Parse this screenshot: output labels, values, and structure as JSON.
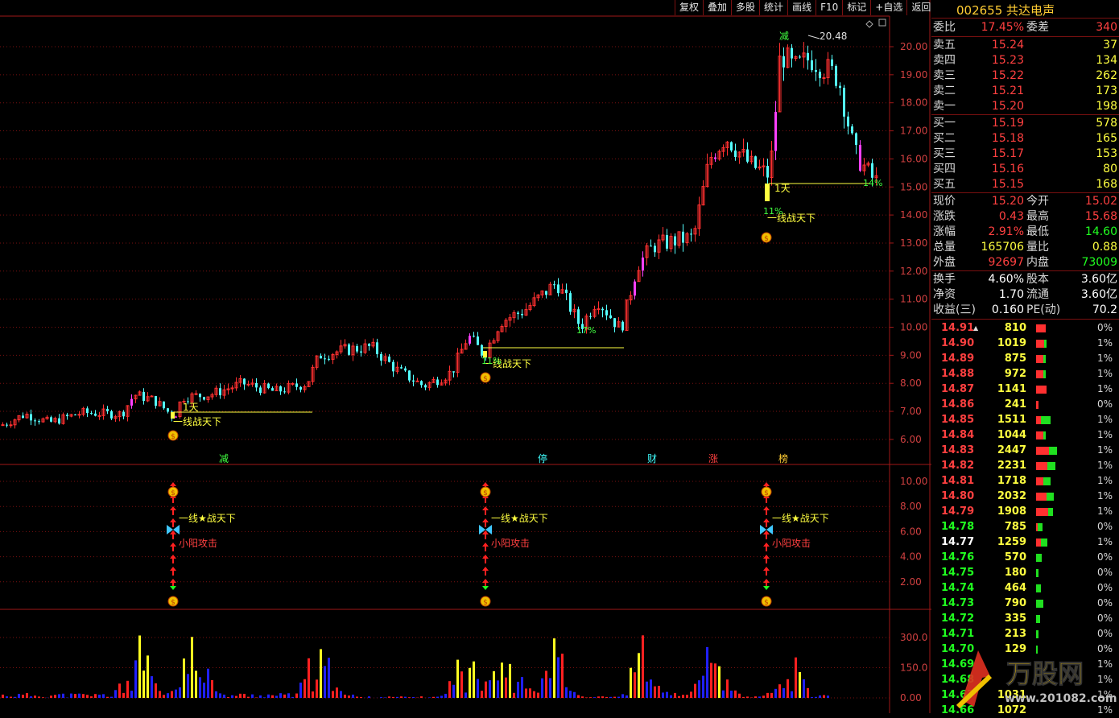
{
  "toolbar": [
    "复权",
    "叠加",
    "多股",
    "统计",
    "画线",
    "F10",
    "标记",
    "+自选",
    "返回"
  ],
  "stock": {
    "code": "002655",
    "name": "共达电声"
  },
  "summary": {
    "weibi_label": "委比",
    "weibi": "17.45%",
    "weicha_label": "委差",
    "weicha": "340"
  },
  "asks": [
    {
      "label": "卖五",
      "price": "15.24",
      "vol": "37"
    },
    {
      "label": "卖四",
      "price": "15.23",
      "vol": "134"
    },
    {
      "label": "卖三",
      "price": "15.22",
      "vol": "262"
    },
    {
      "label": "卖二",
      "price": "15.21",
      "vol": "173"
    },
    {
      "label": "卖一",
      "price": "15.20",
      "vol": "198"
    }
  ],
  "bids": [
    {
      "label": "买一",
      "price": "15.19",
      "vol": "578"
    },
    {
      "label": "买二",
      "price": "15.18",
      "vol": "165"
    },
    {
      "label": "买三",
      "price": "15.17",
      "vol": "153"
    },
    {
      "label": "买四",
      "price": "15.16",
      "vol": "80"
    },
    {
      "label": "买五",
      "price": "15.15",
      "vol": "168"
    }
  ],
  "quote": [
    {
      "l1": "现价",
      "v1": "15.20",
      "c1": "red",
      "l2": "今开",
      "v2": "15.02",
      "c2": "red"
    },
    {
      "l1": "涨跌",
      "v1": "0.43",
      "c1": "red",
      "l2": "最高",
      "v2": "15.68",
      "c2": "red"
    },
    {
      "l1": "涨幅",
      "v1": "2.91%",
      "c1": "red",
      "l2": "最低",
      "v2": "14.60",
      "c2": "green"
    },
    {
      "l1": "总量",
      "v1": "165706",
      "c1": "yel",
      "l2": "量比",
      "v2": "0.88",
      "c2": "yel"
    },
    {
      "l1": "外盘",
      "v1": "92697",
      "c1": "red",
      "l2": "内盘",
      "v2": "73009",
      "c2": "green"
    }
  ],
  "finance": [
    {
      "l1": "换手",
      "v1": "4.60%",
      "l2": "股本",
      "v2": "3.60亿"
    },
    {
      "l1": "净资",
      "v1": "1.70",
      "l2": "流通",
      "v2": "3.60亿"
    },
    {
      "l1": "收益(三)",
      "v1": "0.160",
      "l2": "PE(动)",
      "v2": "70.2"
    }
  ],
  "levels": [
    {
      "p": "14.91",
      "q": "810",
      "pc": "0%",
      "c": "red",
      "r": 12,
      "g": 0
    },
    {
      "p": "14.90",
      "q": "1019",
      "pc": "1%",
      "c": "red",
      "r": 10,
      "g": 3
    },
    {
      "p": "14.89",
      "q": "875",
      "pc": "1%",
      "c": "red",
      "r": 9,
      "g": 3
    },
    {
      "p": "14.88",
      "q": "972",
      "pc": "1%",
      "c": "red",
      "r": 9,
      "g": 3
    },
    {
      "p": "14.87",
      "q": "1141",
      "pc": "1%",
      "c": "red",
      "r": 13,
      "g": 0
    },
    {
      "p": "14.86",
      "q": "241",
      "pc": "0%",
      "c": "red",
      "r": 3,
      "g": 0
    },
    {
      "p": "14.85",
      "q": "1511",
      "pc": "1%",
      "c": "red",
      "r": 6,
      "g": 12
    },
    {
      "p": "14.84",
      "q": "1044",
      "pc": "1%",
      "c": "red",
      "r": 9,
      "g": 3
    },
    {
      "p": "14.83",
      "q": "2447",
      "pc": "1%",
      "c": "red",
      "r": 16,
      "g": 10
    },
    {
      "p": "14.82",
      "q": "2231",
      "pc": "1%",
      "c": "red",
      "r": 14,
      "g": 10
    },
    {
      "p": "14.81",
      "q": "1718",
      "pc": "1%",
      "c": "red",
      "r": 9,
      "g": 9
    },
    {
      "p": "14.80",
      "q": "2032",
      "pc": "1%",
      "c": "red",
      "r": 13,
      "g": 9
    },
    {
      "p": "14.79",
      "q": "1908",
      "pc": "1%",
      "c": "red",
      "r": 15,
      "g": 6
    },
    {
      "p": "14.78",
      "q": "785",
      "pc": "0%",
      "c": "green",
      "r": 2,
      "g": 6
    },
    {
      "p": "14.77",
      "q": "1259",
      "pc": "1%",
      "c": "white",
      "r": 6,
      "g": 8
    },
    {
      "p": "14.76",
      "q": "570",
      "pc": "0%",
      "c": "green",
      "r": 0,
      "g": 7
    },
    {
      "p": "14.75",
      "q": "180",
      "pc": "0%",
      "c": "green",
      "r": 0,
      "g": 3
    },
    {
      "p": "14.74",
      "q": "464",
      "pc": "0%",
      "c": "green",
      "r": 0,
      "g": 6
    },
    {
      "p": "14.73",
      "q": "790",
      "pc": "0%",
      "c": "green",
      "r": 0,
      "g": 9
    },
    {
      "p": "14.72",
      "q": "335",
      "pc": "0%",
      "c": "green",
      "r": 0,
      "g": 5
    },
    {
      "p": "14.71",
      "q": "213",
      "pc": "0%",
      "c": "green",
      "r": 0,
      "g": 3
    },
    {
      "p": "14.70",
      "q": "129",
      "pc": "0%",
      "c": "green",
      "r": 0,
      "g": 2
    },
    {
      "p": "14.69",
      "q": "",
      "pc": "1%",
      "c": "green",
      "r": 0,
      "g": 0
    },
    {
      "p": "14.68",
      "q": "",
      "pc": "1%",
      "c": "green",
      "r": 0,
      "g": 0
    },
    {
      "p": "14.67",
      "q": "1031",
      "pc": "1%",
      "c": "green",
      "r": 0,
      "g": 0
    },
    {
      "p": "14.66",
      "q": "1072",
      "pc": "1%",
      "c": "green",
      "r": 0,
      "g": 0
    }
  ],
  "price_axis": [
    "20.00",
    "19.00",
    "18.00",
    "17.00",
    "16.00",
    "15.00",
    "14.00",
    "13.00",
    "12.00",
    "11.00",
    "10.00",
    "9.00",
    "8.00",
    "7.00",
    "6.00"
  ],
  "ind_axis": [
    "10.00",
    "8.00",
    "6.00",
    "4.00",
    "2.00"
  ],
  "vol_axis": [
    "300.0",
    "150.0",
    "0.00"
  ],
  "annotations": {
    "high_label": "20.48",
    "signal_text": "一线战天下",
    "signal_text2": "一线★战天下",
    "small_yang": "小阳攻击",
    "tian": "1天",
    "pct1": "11%",
    "pct2": "17%",
    "pct3": "11%",
    "pct4": "11%",
    "pct5": "14%",
    "jian": "减",
    "marks": [
      "减",
      "停",
      "财",
      "涨",
      "榜"
    ]
  },
  "watermark": {
    "brand": "万股网",
    "url": "www.201082.com"
  },
  "colors": {
    "up": "#ff3030",
    "down": "#54ffff",
    "grid": "#7a1010",
    "yellow": "#ffff40",
    "magenta": "#ff40ff"
  }
}
